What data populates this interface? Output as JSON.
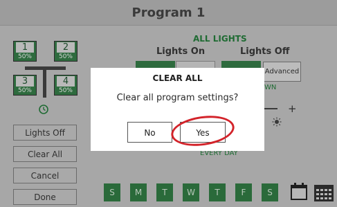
{
  "header": {
    "title": "Program 1"
  },
  "zones": [
    {
      "num": "1",
      "pct": "50%"
    },
    {
      "num": "2",
      "pct": "50%"
    },
    {
      "num": "3",
      "pct": "50%"
    },
    {
      "num": "4",
      "pct": "50%"
    }
  ],
  "left_menu": {
    "lights_off": "Lights Off",
    "clear_all": "Clear All",
    "cancel": "Cancel",
    "done": "Done"
  },
  "program": {
    "group_label": "ALL LIGHTS",
    "lights_on_label": "Lights On",
    "lights_off_label": "Lights Off",
    "advanced_label": "Advanced",
    "down_label": "WN",
    "every_day_label": "EVERY DAY",
    "plus_label": "+"
  },
  "days": [
    "S",
    "M",
    "T",
    "W",
    "T",
    "F",
    "S"
  ],
  "dialog": {
    "title": "CLEAR ALL",
    "message": "Clear all program settings?",
    "no_label": "No",
    "yes_label": "Yes"
  },
  "colors": {
    "zone_green": "#2e6b3e",
    "dialog_highlight": "#d3232a"
  }
}
